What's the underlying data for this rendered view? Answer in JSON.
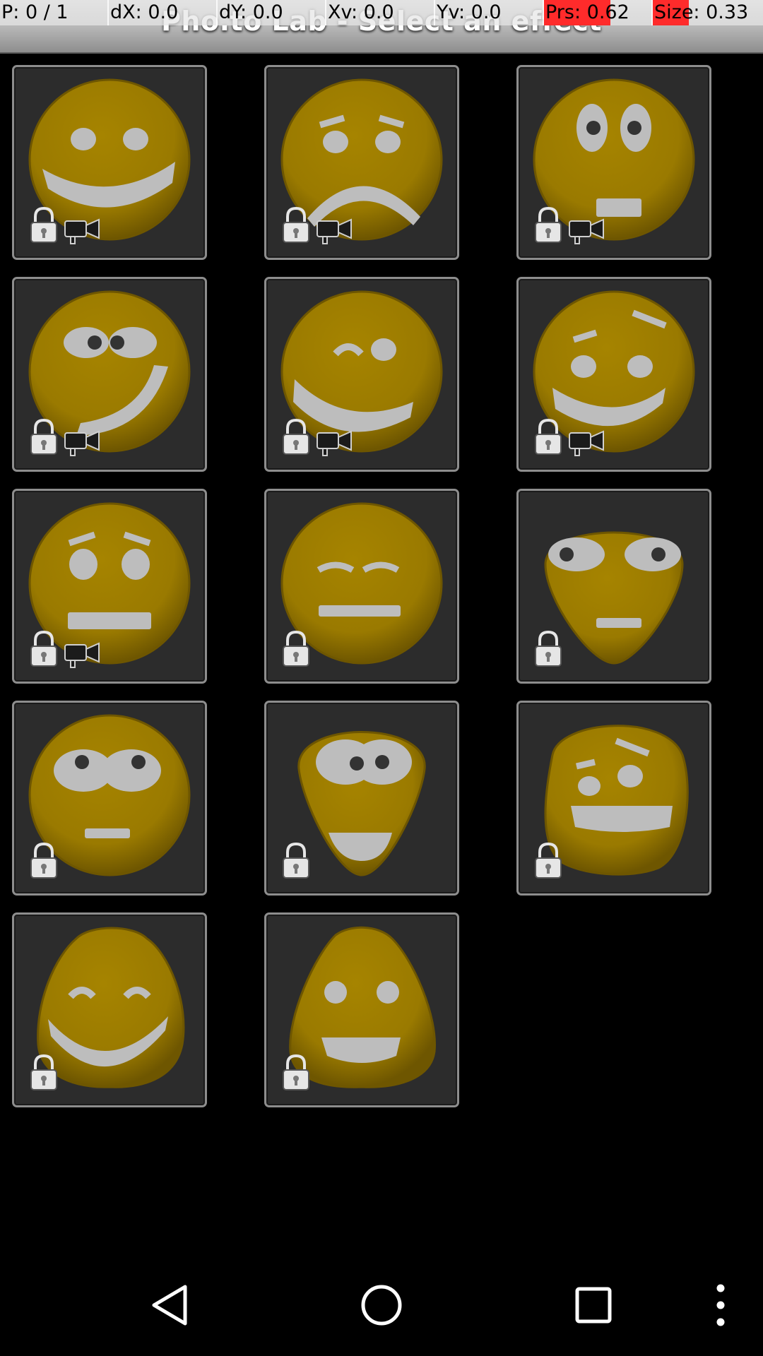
{
  "app": {
    "title": "Pho.to Lab - Select an effect"
  },
  "debug_overlay": [
    {
      "label": "P: 0 / 1",
      "highlight": 0
    },
    {
      "label": "dX: 0.0",
      "highlight": 0
    },
    {
      "label": "dY: 0.0",
      "highlight": 0
    },
    {
      "label": "Xv: 0.0",
      "highlight": 0
    },
    {
      "label": "Yv: 0.0",
      "highlight": 0
    },
    {
      "label": "Prs: 0.62",
      "highlight": 0.62
    },
    {
      "label": "Size: 0.33",
      "highlight": 0.33
    }
  ],
  "colors": {
    "face": "#9a7a00",
    "face_dark": "#6e5600",
    "feature": "#bdbdbd",
    "tile_bg": "#2c2c2c",
    "tile_border": "#8d8d8d"
  },
  "effects": [
    {
      "face": "smile",
      "locked": true,
      "video": true
    },
    {
      "face": "sad",
      "locked": true,
      "video": true
    },
    {
      "face": "surprised",
      "locked": true,
      "video": true
    },
    {
      "face": "crazy",
      "locked": true,
      "video": true
    },
    {
      "face": "wink",
      "locked": true,
      "video": true
    },
    {
      "face": "raised-brow-smile",
      "locked": true,
      "video": true
    },
    {
      "face": "nervous",
      "locked": true,
      "video": true
    },
    {
      "face": "bored",
      "locked": true,
      "video": false
    },
    {
      "face": "alien",
      "locked": true,
      "video": false
    },
    {
      "face": "stare",
      "locked": true,
      "video": false
    },
    {
      "face": "wide-eyed-grin",
      "locked": true,
      "video": false
    },
    {
      "face": "toothy-grin",
      "locked": true,
      "video": false
    },
    {
      "face": "happy-blob",
      "locked": true,
      "video": false
    },
    {
      "face": "pear-grin",
      "locked": true,
      "video": false
    }
  ],
  "icons": {
    "lock": "lock-icon",
    "video": "video-camera-icon",
    "back": "back-triangle-icon",
    "home": "home-circle-icon",
    "recents": "recents-square-icon",
    "menu": "overflow-menu-icon"
  }
}
